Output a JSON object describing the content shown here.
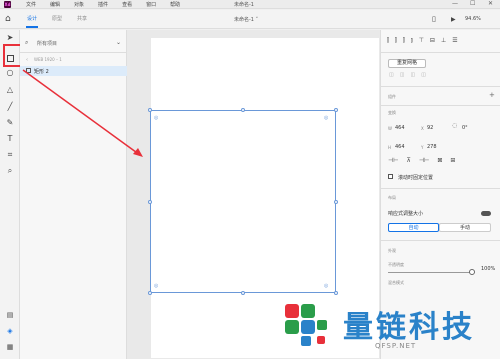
{
  "titlebar": {
    "logo": "Xd",
    "menus": [
      "文件",
      "编辑",
      "对象",
      "插件",
      "查看",
      "窗口",
      "帮助"
    ],
    "window_title": "未命名-1",
    "controls": [
      "—",
      "☐",
      "✕"
    ]
  },
  "header": {
    "tabs": [
      {
        "label": "设计",
        "active": true
      },
      {
        "label": "原型",
        "active": false
      },
      {
        "label": "共享",
        "active": false
      }
    ],
    "doc_title": "未命名-1 ˅",
    "zoom": "94.6%"
  },
  "layers": {
    "search_placeholder": "所有项目",
    "breadcrumb": "WEB 1920 – 1",
    "items": [
      {
        "label": "矩形 2"
      }
    ]
  },
  "properties": {
    "repeat_grid": "重复网格",
    "component_label": "组件",
    "transform_label": "变换",
    "w_label": "W",
    "w_value": "464",
    "h_label": "H",
    "h_value": "464",
    "x_label": "X",
    "x_value": "92",
    "y_label": "Y",
    "y_value": "278",
    "rotation": "0°",
    "fix_position": "滚动时固定位置",
    "layout_label": "布局",
    "responsive_resize": "响应式调整大小",
    "auto_label": "自动",
    "manual_label": "手动",
    "appearance_label": "外观",
    "opacity_label": "不透明度",
    "opacity_value": "100%",
    "opacity_fraction": 1.0,
    "blend_label": "混合模式"
  },
  "watermark": {
    "text": "量链科技",
    "sub": "QFSP.NET"
  }
}
